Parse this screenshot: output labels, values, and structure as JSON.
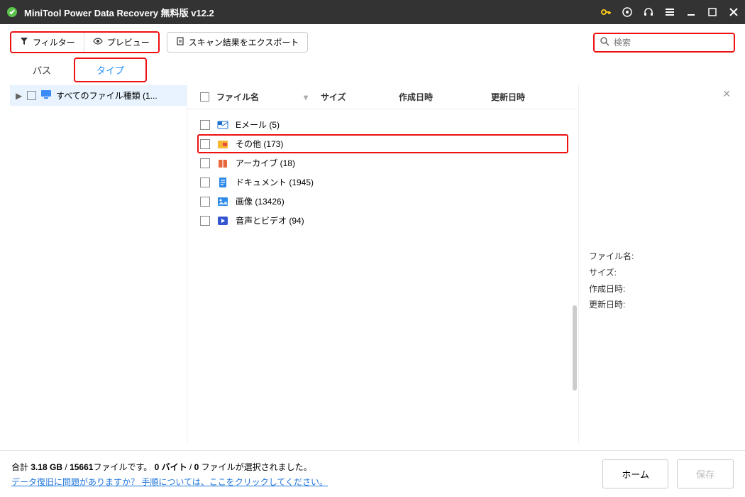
{
  "titlebar": {
    "title": "MiniTool Power Data Recovery 無料版 v12.2"
  },
  "toolbar": {
    "filter": "フィルター",
    "preview": "プレビュー",
    "export": "スキャン結果をエクスポート",
    "search_placeholder": "検索"
  },
  "tabs": {
    "path": "パス",
    "type": "タイプ"
  },
  "tree": {
    "root": "すべてのファイル種類 (1..."
  },
  "columns": {
    "name": "ファイル名",
    "size": "サイズ",
    "created": "作成日時",
    "modified": "更新日時"
  },
  "rows": [
    {
      "icon": "email",
      "label": "Eメール (5)"
    },
    {
      "icon": "other",
      "label": "その他 (173)",
      "highlight": true
    },
    {
      "icon": "archive",
      "label": "アーカイブ (18)"
    },
    {
      "icon": "doc",
      "label": "ドキュメント (1945)"
    },
    {
      "icon": "image",
      "label": "画像 (13426)"
    },
    {
      "icon": "media",
      "label": "音声とビデオ (94)"
    }
  ],
  "meta": {
    "filename_label": "ファイル名:",
    "size_label": "サイズ:",
    "created_label": "作成日時:",
    "modified_label": "更新日時:"
  },
  "footer": {
    "status_prefix": "合計 ",
    "total_size": "3.18 GB",
    "sep1": " / ",
    "total_files": "15661",
    "files_suffix": "ファイルです。 ",
    "selected_bytes": "0 バイト",
    "sep2": "  /  ",
    "selected_count": "0 ",
    "selected_suffix": "ファイルが選択されました。",
    "help": "データ復旧に問題がありますか？ 手順については、ここをクリックしてください。",
    "home": "ホーム",
    "save": "保存"
  }
}
